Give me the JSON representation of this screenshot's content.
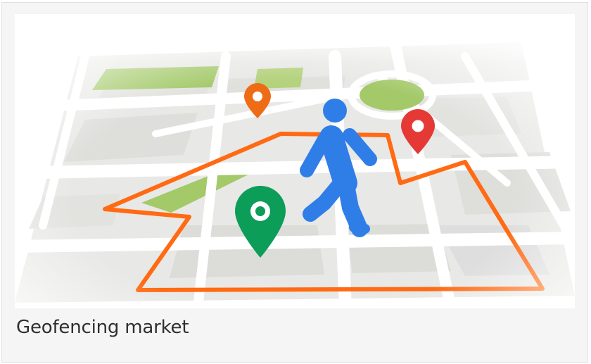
{
  "caption": "Geofencing market",
  "colors": {
    "boundary": "#ff6a13",
    "person": "#2f7ee8",
    "pin_green": "#0c9d58",
    "pin_orange": "#ef6c17",
    "pin_red": "#e53935",
    "park": "#a3c969",
    "road": "#ffffff",
    "block": "#e7e7e5"
  },
  "icons": [
    "map-illustration",
    "walking-person-icon",
    "location-pin-icon"
  ]
}
